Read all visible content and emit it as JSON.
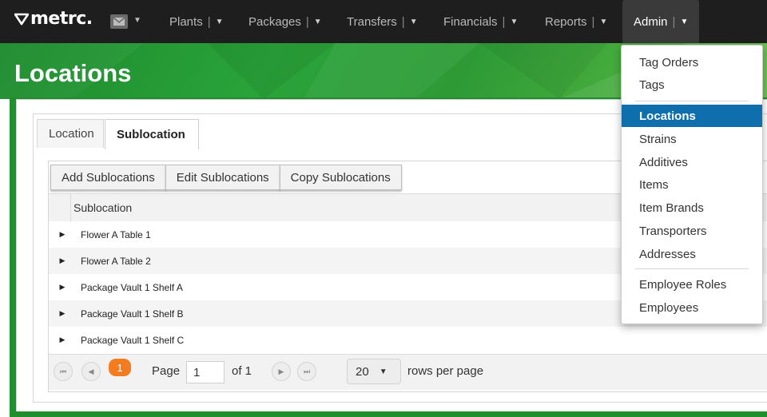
{
  "app": {
    "logo_text": "metrc."
  },
  "nav": {
    "items": [
      {
        "label": "Plants"
      },
      {
        "label": "Packages"
      },
      {
        "label": "Transfers"
      },
      {
        "label": "Financials"
      },
      {
        "label": "Reports"
      },
      {
        "label": "Admin"
      }
    ],
    "active": "Admin"
  },
  "page": {
    "title": "Locations"
  },
  "tabs": [
    {
      "label": "Location"
    },
    {
      "label": "Sublocation"
    }
  ],
  "active_tab": "Sublocation",
  "toolbar": {
    "add_label": "Add Sublocations",
    "edit_label": "Edit Sublocations",
    "copy_label": "Copy Sublocations"
  },
  "table": {
    "column_header": "Sublocation",
    "rows": [
      {
        "name": "Flower A Table 1"
      },
      {
        "name": "Flower A Table 2"
      },
      {
        "name": "Package Vault 1 Shelf A"
      },
      {
        "name": "Package Vault 1 Shelf B"
      },
      {
        "name": "Package Vault 1 Shelf C"
      }
    ]
  },
  "pager": {
    "page_badge": "1",
    "page_label": "Page",
    "page_value": "1",
    "of_label": "of 1",
    "rows_value": "20",
    "rows_label": "rows per page"
  },
  "admin_menu": {
    "groups": [
      [
        "Tag Orders",
        "Tags"
      ],
      [
        "Locations",
        "Strains",
        "Additives",
        "Items",
        "Item Brands",
        "Transporters",
        "Addresses"
      ],
      [
        "Employee Roles",
        "Employees"
      ]
    ],
    "selected": "Locations"
  },
  "colors": {
    "nav_bg": "#1e1e1e",
    "banner_green": "#2aa33a",
    "menu_selected": "#0f6fad",
    "page_badge": "#f47c20"
  }
}
